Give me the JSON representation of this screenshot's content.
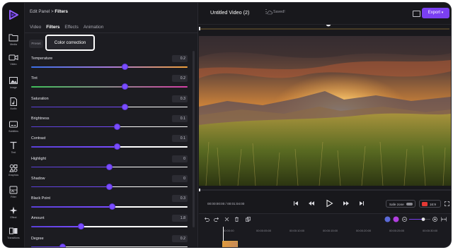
{
  "app": {
    "accent": "#7b3ff2",
    "logo_icon": "play-logo-icon"
  },
  "rail": {
    "items": [
      {
        "label": "Media",
        "icon": "folder-icon"
      },
      {
        "label": "Video",
        "icon": "video-camera-icon"
      },
      {
        "label": "Image",
        "icon": "image-icon"
      },
      {
        "label": "Audio",
        "icon": "audio-file-icon"
      },
      {
        "label": "Subtitles",
        "icon": "subtitles-icon"
      },
      {
        "label": "Text",
        "icon": "text-icon"
      },
      {
        "label": "Graphics",
        "icon": "graphics-icon"
      },
      {
        "label": "Filter",
        "icon": "filter-icon"
      },
      {
        "label": "Effect",
        "icon": "sparkle-icon"
      },
      {
        "label": "Transitions",
        "icon": "transitions-icon"
      }
    ]
  },
  "panel": {
    "breadcrumb_parent": "Edit Panel",
    "breadcrumb_sep": ">",
    "breadcrumb_current": "Filters",
    "tabs": [
      {
        "label": "Video",
        "active": false
      },
      {
        "label": "Filters",
        "active": true
      },
      {
        "label": "Effects",
        "active": false
      },
      {
        "label": "Animation",
        "active": false
      }
    ],
    "preset_label": "Preset",
    "color_correction_label": "Color correction",
    "sliders": [
      {
        "label": "Temperature",
        "value": "0.2",
        "level": 0.6
      },
      {
        "label": "Tint",
        "value": "0.2",
        "level": 0.6
      },
      {
        "label": "Saturation",
        "value": "0.3",
        "level": 0.6
      },
      {
        "label": "Brightness",
        "value": "0.1",
        "level": 0.55
      },
      {
        "label": "Contrast",
        "value": "0.1",
        "level": 0.55
      },
      {
        "label": "Highlight",
        "value": "0",
        "level": 0.5
      },
      {
        "label": "Shadow",
        "value": "0",
        "level": 0.5
      },
      {
        "label": "Black Point",
        "value": "0.3",
        "level": 0.52
      },
      {
        "label": "Amount",
        "value": "1.8",
        "level": 0.32
      },
      {
        "label": "Degree",
        "value": "0.2",
        "level": 0.2
      }
    ]
  },
  "topbar": {
    "title": "Untitled Video (2)",
    "more_icon": "more-vertical-icon",
    "saved_icon": "cloud-check-icon",
    "saved_text": "Saved!",
    "keyboard_icon": "keyboard-icon",
    "export_label": "Export",
    "export_chevron": "chevron-down-icon"
  },
  "controls": {
    "timecode": "00:00:00:00 / 00:01:04:00",
    "safe_zone_label": "Safe zone",
    "ratio_label": "16:9",
    "playback_icons": [
      "skip-back-icon",
      "rewind-icon",
      "play-icon",
      "fast-forward-icon",
      "skip-forward-icon"
    ]
  },
  "timeline": {
    "ticks": [
      "00:00:00",
      "00:00:05:00",
      "00:00:10:00",
      "00:00:15:00",
      "00:00:20:00",
      "00:00:25:00",
      "00:00:30:00"
    ]
  }
}
